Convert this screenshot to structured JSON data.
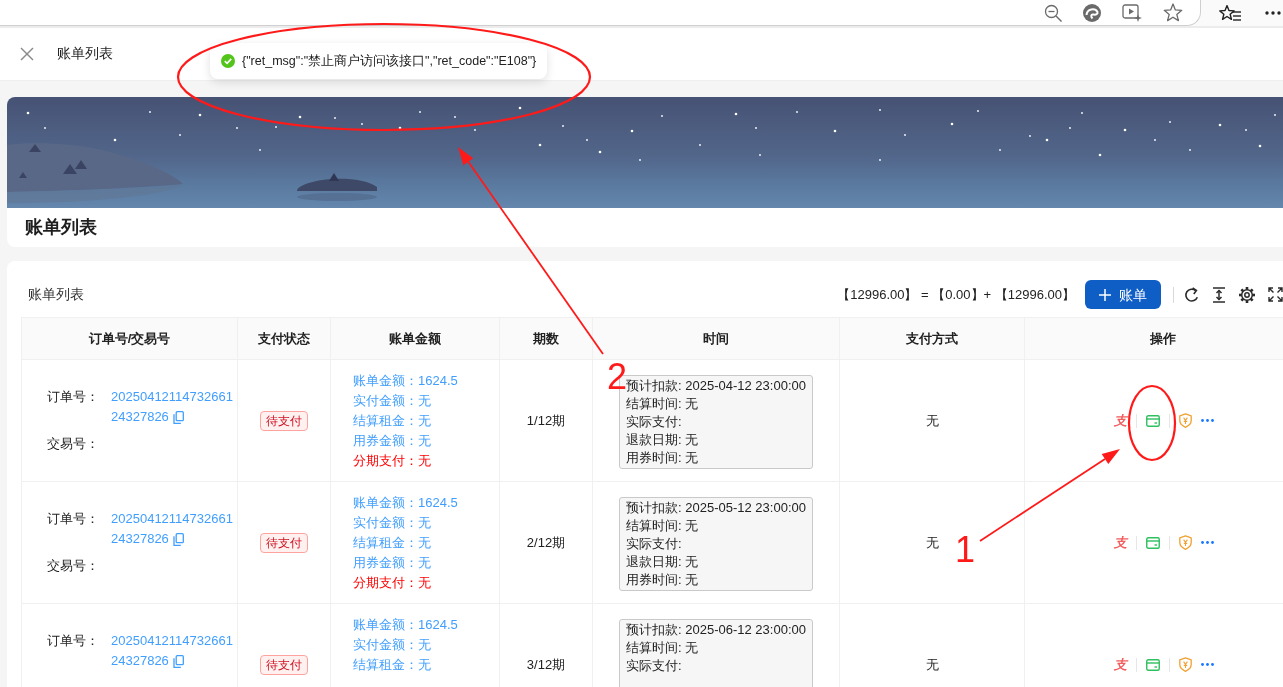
{
  "page_tab": {
    "title": "账单列表"
  },
  "toast": {
    "kind": "success",
    "message": "{\"ret_msg\":\"禁止商户访问该接口\",\"ret_code\":\"E108\"}"
  },
  "banner": {
    "title": "账单列表"
  },
  "bill_list": {
    "title": "账单列表",
    "summary": "【12996.00】 = 【0.00】+ 【12996.00】",
    "add_button": "账单",
    "table": {
      "columns": [
        "订单号/交易号",
        "支付状态",
        "账单金额",
        "期数",
        "时间",
        "支付方式",
        "操作"
      ],
      "rows": [
        {
          "order_label": "订单号：",
          "order_no": [
            "20250412114732661",
            "24327826"
          ],
          "trade_label": "交易号：",
          "status": "待支付",
          "amounts": [
            {
              "text": "账单金额：1624.5",
              "warning": false
            },
            {
              "text": "实付金额：无",
              "warning": false
            },
            {
              "text": "结算租金：无",
              "warning": false
            },
            {
              "text": "用券金额：无",
              "warning": false
            },
            {
              "text": "分期支付：无",
              "warning": true
            }
          ],
          "period": "1/12期",
          "times": [
            "预计扣款: 2025-04-12 23:00:00",
            "结算时间: 无",
            "实际支付:",
            "退款日期: 无",
            "用券时间: 无"
          ],
          "pay_method": "无",
          "actions": [
            {
              "kind": "pay",
              "text": "支"
            },
            {
              "kind": "card"
            },
            {
              "kind": "shield"
            },
            {
              "kind": "more"
            }
          ]
        },
        {
          "order_label": "订单号：",
          "order_no": [
            "20250412114732661",
            "24327826"
          ],
          "trade_label": "交易号：",
          "status": "待支付",
          "amounts": [
            {
              "text": "账单金额：1624.5",
              "warning": false
            },
            {
              "text": "实付金额：无",
              "warning": false
            },
            {
              "text": "结算租金：无",
              "warning": false
            },
            {
              "text": "用券金额：无",
              "warning": false
            },
            {
              "text": "分期支付：无",
              "warning": true
            }
          ],
          "period": "2/12期",
          "times": [
            "预计扣款: 2025-05-12 23:00:00",
            "结算时间: 无",
            "实际支付:",
            "退款日期: 无",
            "用券时间: 无"
          ],
          "pay_method": "无",
          "actions": [
            {
              "kind": "pay",
              "text": "支"
            },
            {
              "kind": "card"
            },
            {
              "kind": "shield"
            },
            {
              "kind": "more"
            }
          ]
        },
        {
          "order_label": "订单号：",
          "order_no": [
            "20250412114732661",
            "24327826"
          ],
          "status": "待支付",
          "amounts": [
            {
              "text": "账单金额：1624.5",
              "warning": false
            },
            {
              "text": "实付金额：无",
              "warning": false
            },
            {
              "text": "结算租金：无",
              "warning": false
            }
          ],
          "period": "3/12期",
          "times": [
            "预计扣款: 2025-06-12 23:00:00",
            "结算时间: 无",
            "实际支付:"
          ],
          "pay_method": "无",
          "actions": [
            {
              "kind": "pay",
              "text": "支"
            },
            {
              "kind": "card"
            },
            {
              "kind": "shield"
            },
            {
              "kind": "more"
            }
          ]
        }
      ]
    }
  },
  "annotations": [
    {
      "number": "2"
    },
    {
      "number": "1"
    }
  ]
}
